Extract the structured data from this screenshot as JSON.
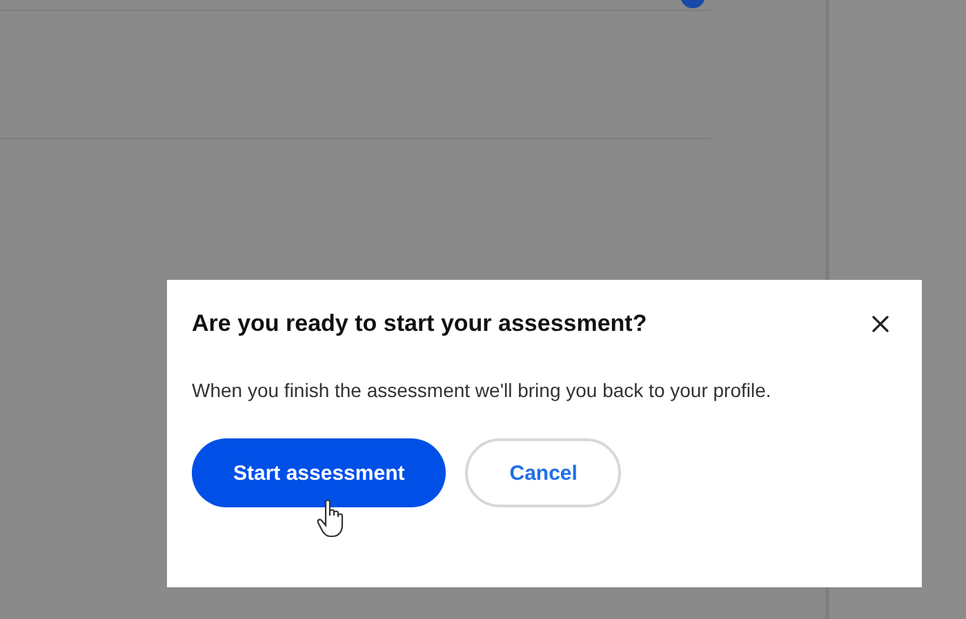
{
  "dialog": {
    "title": "Are you ready to start your assessment?",
    "message": "When you finish the assessment we'll bring you back to your profile.",
    "buttons": [
      {
        "label": "Start assessment",
        "kind": "primary",
        "hovered": true
      },
      {
        "label": "Cancel",
        "kind": "secondary",
        "hovered": false
      }
    ]
  }
}
